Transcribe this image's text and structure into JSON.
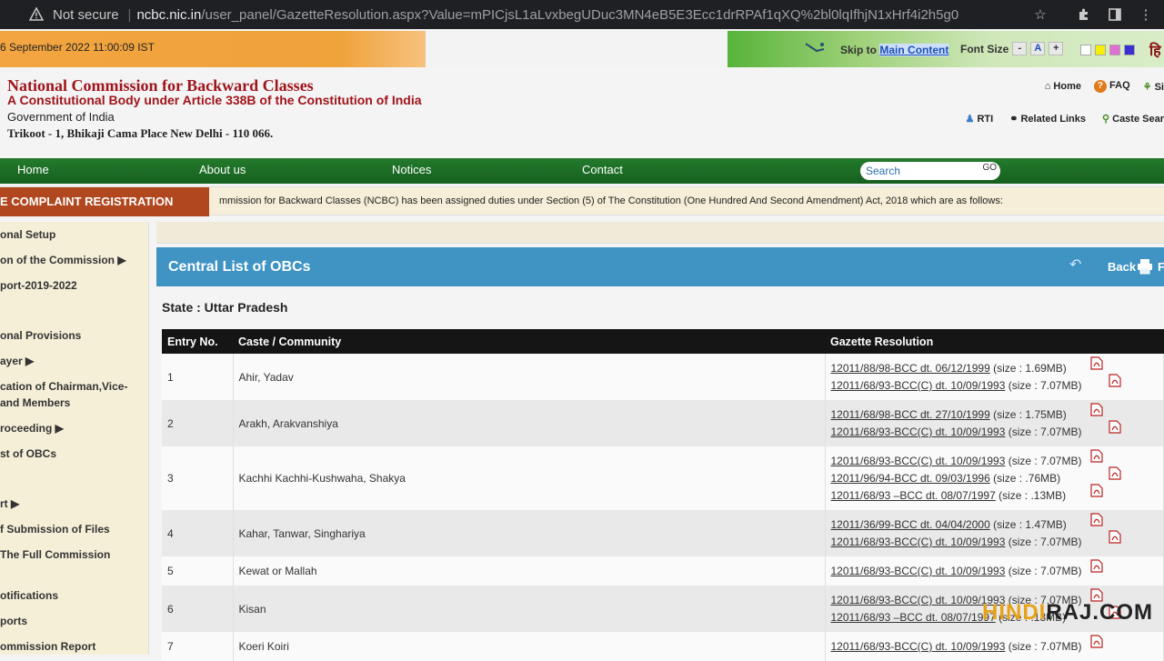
{
  "browser": {
    "security_label": "Not secure",
    "url_host": "ncbc.nic.in",
    "url_path": "/user_panel/GazetteResolution.aspx?Value=mPICjsL1aLvxbegUDuc3MN4eB5E3Ecc1drRPAf1qXQ%2bl0lqIfhjN1xHrf4i2h5g0"
  },
  "topbar": {
    "datetime": "6 September 2022 11:00:09 IST",
    "skip_label": "Skip to",
    "skip_link": "Main Content",
    "font_size_label": "Font Size",
    "font_minus": "-",
    "font_normal": "A",
    "font_plus": "+"
  },
  "header": {
    "org_name": "National Commission for Backward Classes",
    "org_tagline": "A Constitutional Body under Article 338B of the Constitution of India",
    "org_gov": "Government of India",
    "org_address": "Trikoot - 1, Bhikaji Cama Place New Delhi - 110 066.",
    "links": {
      "home": "Home",
      "faq": "FAQ",
      "sitemap": "Si",
      "rti": "RTI",
      "related": "Related Links",
      "caste": "Caste Sear"
    }
  },
  "nav": {
    "items": [
      "Home",
      "About us",
      "Notices",
      "Contact"
    ],
    "search_placeholder": "Search",
    "go_label": "GO"
  },
  "ticker": {
    "label": "E COMPLAINT REGISTRATION",
    "message": "mmission for Backward Classes (NCBC) has been assigned duties under Section (5) of The Constitution (One Hundred And Second Amendment) Act, 2018 which are as follows:"
  },
  "sidebar": {
    "items": [
      "onal Setup",
      "on of the Commission ▶",
      "port-2019-2022",
      "onal Provisions",
      "ayer ▶",
      "cation of Chairman,Vice-",
      "and Members",
      "roceeding ▶",
      "st of OBCs",
      "rt ▶",
      "f Submission of Files",
      "The Full Commission",
      "otifications",
      "ports",
      "ommission Report"
    ]
  },
  "panel": {
    "title": "Central List of OBCs",
    "back_label": "Back",
    "print_label": "F",
    "state_label": "State : Uttar Pradesh"
  },
  "table": {
    "columns": [
      "Entry No.",
      "Caste / Community",
      "Gazette Resolution"
    ],
    "rows": [
      {
        "no": "1",
        "caste": "Ahir, Yadav",
        "res": [
          {
            "link": "12011/88/98-BCC dt. 06/12/1999",
            "size": "(size : 1.69MB)"
          },
          {
            "link": "12011/68/93-BCC(C) dt. 10/09/1993",
            "size": "(size : 7.07MB)"
          }
        ]
      },
      {
        "no": "2",
        "caste": "Arakh, Arakvanshiya",
        "res": [
          {
            "link": "12011/68/98-BCC dt. 27/10/1999",
            "size": "(size : 1.75MB)"
          },
          {
            "link": "12011/68/93-BCC(C) dt. 10/09/1993",
            "size": "(size : 7.07MB)"
          }
        ]
      },
      {
        "no": "3",
        "caste": "Kachhi Kachhi-Kushwaha, Shakya",
        "res": [
          {
            "link": "12011/68/93-BCC(C) dt. 10/09/1993",
            "size": "(size : 7.07MB)"
          },
          {
            "link": "12011/96/94-BCC dt. 09/03/1996",
            "size": "(size : .76MB)"
          },
          {
            "link": "12011/68/93 –BCC dt. 08/07/1997",
            "size": "(size : .13MB)"
          }
        ]
      },
      {
        "no": "4",
        "caste": "Kahar, Tanwar, Singhariya",
        "res": [
          {
            "link": "12011/36/99-BCC dt. 04/04/2000",
            "size": "(size : 1.47MB)"
          },
          {
            "link": "12011/68/93-BCC(C) dt. 10/09/1993",
            "size": "(size : 7.07MB)"
          }
        ]
      },
      {
        "no": "5",
        "caste": "Kewat or Mallah",
        "res": [
          {
            "link": "12011/68/93-BCC(C) dt. 10/09/1993",
            "size": "(size : 7.07MB)"
          }
        ]
      },
      {
        "no": "6",
        "caste": "Kisan",
        "res": [
          {
            "link": "12011/68/93-BCC(C) dt. 10/09/1993",
            "size": "(size : 7.07MB)"
          },
          {
            "link": "12011/68/93 –BCC dt. 08/07/1997",
            "size": "(size : .13MB)"
          }
        ]
      },
      {
        "no": "7",
        "caste": "Koeri Koiri",
        "res": [
          {
            "link": "12011/68/93-BCC(C) dt. 10/09/1993",
            "size": "(size : 7.07MB)"
          }
        ]
      }
    ]
  },
  "watermark": {
    "part1": "HINDI",
    "part2": "RAJ.COM"
  },
  "colors": {
    "brand_red": "#a0141b",
    "nav_green": "#1d6e26",
    "panel_blue": "#3f94c4",
    "ticker_label": "#b1471f"
  }
}
